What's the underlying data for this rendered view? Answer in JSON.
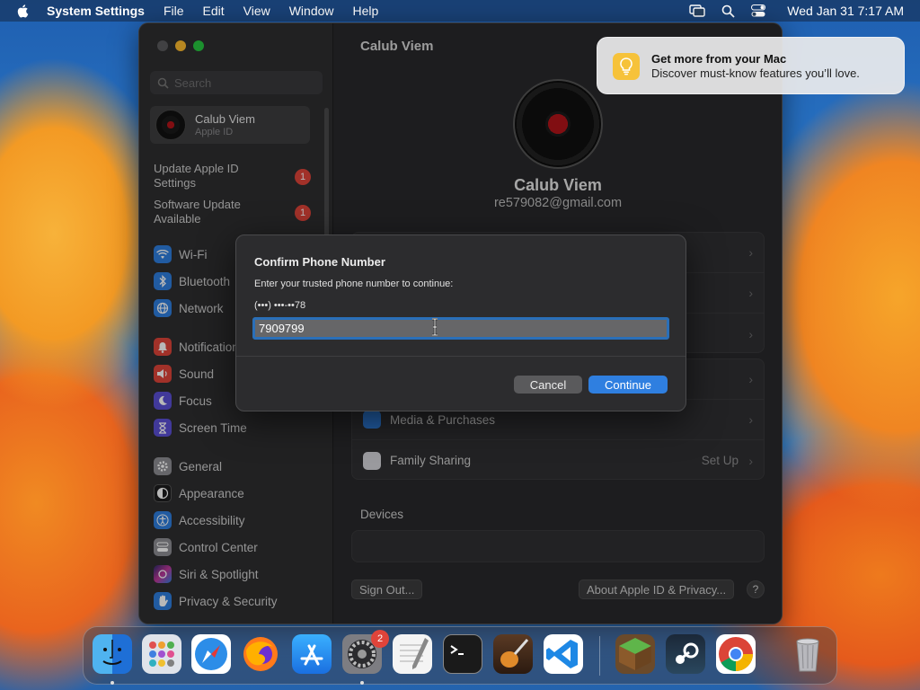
{
  "menubar": {
    "app_name": "System Settings",
    "items": [
      "File",
      "Edit",
      "View",
      "Window",
      "Help"
    ],
    "clock": "Wed Jan 31  7:17 AM"
  },
  "sidebar": {
    "search_placeholder": "Search",
    "account": {
      "name": "Calub Viem",
      "subtitle": "Apple ID"
    },
    "notices": [
      {
        "label": "Update Apple ID Settings",
        "badge": "1"
      },
      {
        "label": "Software Update Available",
        "badge": "1"
      }
    ],
    "items": [
      {
        "label": "Wi-Fi",
        "icon": "wifi-icon",
        "color": "#2f7fe0"
      },
      {
        "label": "Bluetooth",
        "icon": "bluetooth-icon",
        "color": "#2f7fe0"
      },
      {
        "label": "Network",
        "icon": "globe-icon",
        "color": "#2f7fe0"
      },
      {
        "label": "Notifications",
        "icon": "bell-icon",
        "color": "#e0443a"
      },
      {
        "label": "Sound",
        "icon": "speaker-icon",
        "color": "#e0443a"
      },
      {
        "label": "Focus",
        "icon": "moon-icon",
        "color": "#5b4fd6"
      },
      {
        "label": "Screen Time",
        "icon": "hourglass-icon",
        "color": "#5b4fd6"
      },
      {
        "label": "General",
        "icon": "gear-icon",
        "color": "#8e8e93"
      },
      {
        "label": "Appearance",
        "icon": "appearance-icon",
        "color": "#1c1c1e"
      },
      {
        "label": "Accessibility",
        "icon": "accessibility-icon",
        "color": "#2f7fe0"
      },
      {
        "label": "Control Center",
        "icon": "control-center-icon",
        "color": "#8e8e93"
      },
      {
        "label": "Siri & Spotlight",
        "icon": "siri-icon",
        "color": "#c0389a"
      },
      {
        "label": "Privacy & Security",
        "icon": "hand-icon",
        "color": "#2f7fe0"
      }
    ]
  },
  "main": {
    "title": "Calub Viem",
    "profile_name": "Calub Viem",
    "profile_email": "re579082@gmail.com",
    "rows_lower": [
      {
        "label": "Media & Purchases",
        "value": ""
      },
      {
        "label": "Family Sharing",
        "value": "Set Up"
      }
    ],
    "devices_title": "Devices",
    "sign_out": "Sign Out...",
    "about": "About Apple ID & Privacy...",
    "help": "?"
  },
  "dialog": {
    "title": "Confirm Phone Number",
    "prompt": "Enter your trusted phone number to continue:",
    "masked_number": "(•••) •••-••78",
    "input_value": "7909799",
    "cancel": "Cancel",
    "continue": "Continue"
  },
  "notification": {
    "title": "Get more from your Mac",
    "body": "Discover must-know features you’ll love.",
    "icon": "lightbulb-icon"
  },
  "dock": {
    "badge_settings": "2",
    "apps": [
      "finder-icon",
      "launchpad-icon",
      "safari-icon",
      "firefox-icon",
      "app-store-icon",
      "system-settings-icon",
      "textedit-icon",
      "terminal-icon",
      "garageband-icon",
      "vscode-icon",
      "minecraft-icon",
      "steam-icon",
      "chrome-icon",
      "trash-icon"
    ]
  }
}
